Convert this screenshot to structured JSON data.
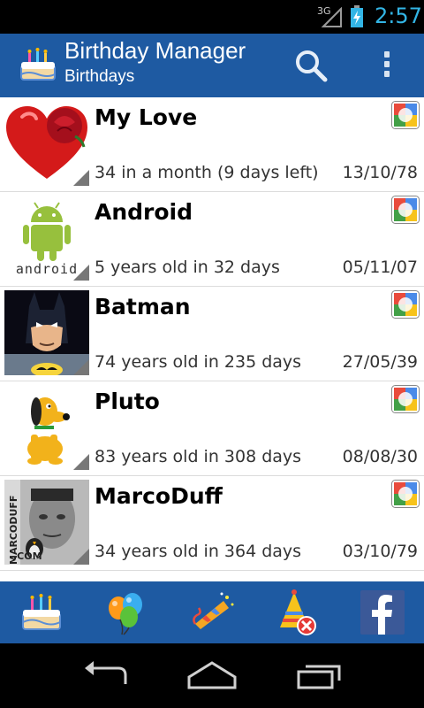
{
  "status_bar": {
    "network": "3G",
    "time": "2:57"
  },
  "action_bar": {
    "title": "Birthday Manager",
    "subtitle": "Birthdays",
    "app_icon": "birthday-cake-icon",
    "search_icon": "search-icon",
    "overflow_icon": "overflow-menu-icon"
  },
  "contacts": [
    {
      "name": "My Love",
      "info": "34 in a month (9 days left)",
      "date": "13/10/78",
      "avatar": "heart-rose-avatar",
      "source_icon": "google-icon"
    },
    {
      "name": "Android",
      "info": "5 years old in 32 days",
      "date": "05/11/07",
      "avatar": "android-avatar",
      "avatar_caption": "android",
      "source_icon": "google-icon"
    },
    {
      "name": "Batman",
      "info": "74 years old in 235 days",
      "date": "27/05/39",
      "avatar": "batman-avatar",
      "source_icon": "google-icon"
    },
    {
      "name": "Pluto",
      "info": "83 years old in 308 days",
      "date": "08/08/30",
      "avatar": "pluto-avatar",
      "source_icon": "google-icon"
    },
    {
      "name": "MarcoDuff",
      "info": "34 years old in 364 days",
      "date": "03/10/79",
      "avatar": "marcoduff-avatar",
      "avatar_caption_side": "MARCODUFF",
      "avatar_caption_bottom": ".COM",
      "source_icon": "google-icon"
    }
  ],
  "bottom_bar": {
    "tabs": [
      "birthday-cake-icon",
      "balloons-icon",
      "party-horn-icon",
      "party-hat-remove-icon",
      "facebook-icon"
    ]
  },
  "nav_bar": {
    "buttons": [
      "back-icon",
      "home-icon",
      "recent-apps-icon"
    ]
  },
  "colors": {
    "bar_blue": "#1e5aa2",
    "clock": "#33b5e5"
  }
}
